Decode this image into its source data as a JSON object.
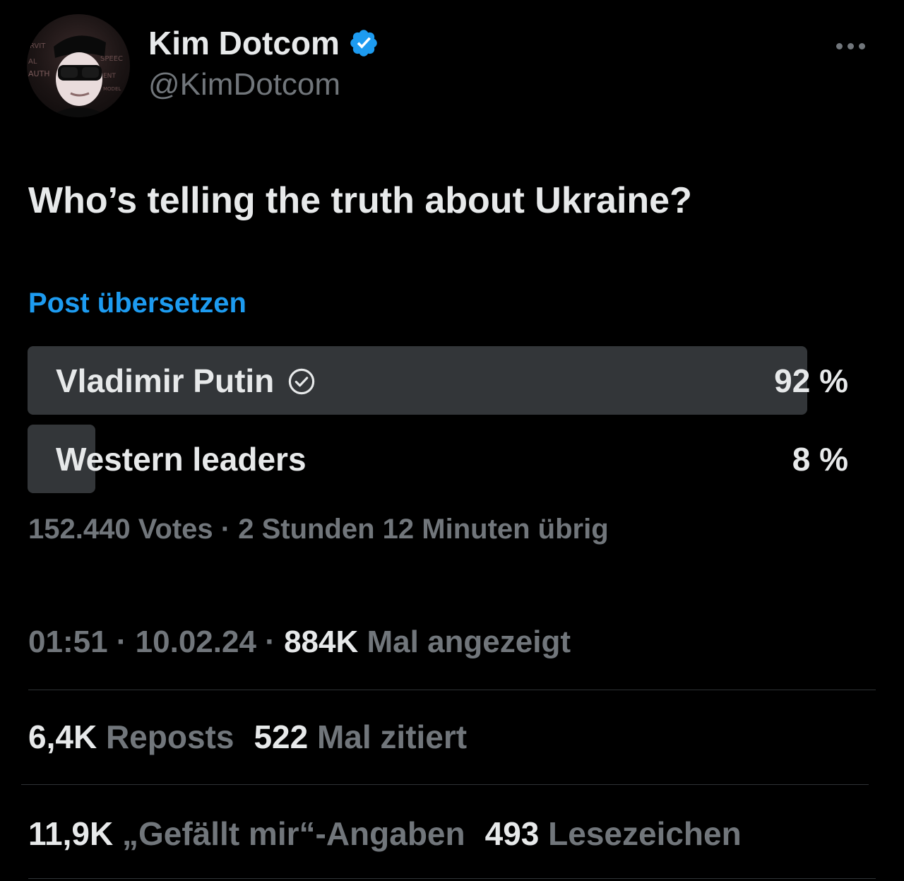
{
  "author": {
    "display_name": "Kim Dotcom",
    "handle": "@KimDotcom",
    "verified": true,
    "avatar_icon": "profile-photo",
    "avatar_text": [
      "RVIT",
      "AL",
      "AUTH",
      "SPEEC",
      "ENT",
      "MODEL"
    ]
  },
  "more_icon": "more-horizontal-icon",
  "tweet": {
    "text": "Who’s telling the truth about Ukraine?",
    "translate_label": "Post übersetzen"
  },
  "poll": {
    "options": [
      {
        "label": "Vladimir Putin",
        "percent_label": "92 %",
        "percent": 92,
        "selected": true
      },
      {
        "label": "Western leaders",
        "percent_label": "8 %",
        "percent": 8,
        "selected": false
      }
    ],
    "meta": "152.440 Votes · 2 Stunden 12 Minuten übrig"
  },
  "timestamp": {
    "time": "01:51",
    "separator": "·",
    "date": "10.02.24",
    "views_count": "884K",
    "views_label": "Mal angezeigt"
  },
  "stats": {
    "reposts_count": "6,4K",
    "reposts_label": "Reposts",
    "quotes_count": "522",
    "quotes_label": "Mal zitiert",
    "likes_count": "11,9K",
    "likes_label": "„Gefällt mir“-Angaben",
    "bookmarks_count": "493",
    "bookmarks_label": "Lesezeichen"
  },
  "colors": {
    "background": "#000000",
    "text_primary": "#e7e9ea",
    "text_secondary": "#71767b",
    "accent": "#1d9bf0",
    "poll_bar": "#333639",
    "divider": "#2f3336"
  }
}
